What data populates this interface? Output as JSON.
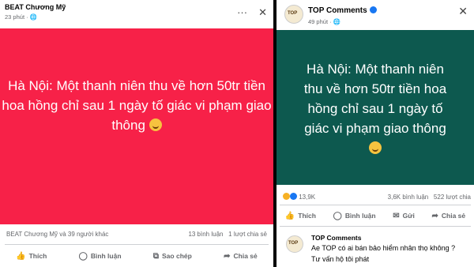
{
  "left_post": {
    "author": "BEAT Chương Mỹ",
    "time": "23 phút · 🌐",
    "text_lines": [
      "Hà Nội: Một thanh niên thu về hơn 50tr tiền",
      "hoa hồng chỉ sau 1 ngày tố giác vi phạm giao",
      "thông"
    ],
    "banner_color": "#f72148",
    "reactions": "BEAT Chương Mỹ và 39 người khác",
    "counts": "13 bình luận   1 lượt chia sẻ",
    "buttons": {
      "like": "Thích",
      "comment": "Bình luận",
      "copy": "Sao chép",
      "share": "Chia sẻ"
    }
  },
  "right_post": {
    "author": "TOP Comments",
    "time": "49 phút · 🌐",
    "text_lines": [
      "Hà Nội: Một thanh niên",
      "thu về hơn 50tr tiền hoa",
      "hồng chỉ sau 1 ngày tố",
      "giác vi phạm giao thông"
    ],
    "banner_color": "#0d594f",
    "reaction_count": "13,9K",
    "comments_count": "3,6K bình luận",
    "shares_count": "522 lượt chia",
    "buttons": {
      "like": "Thích",
      "comment": "Bình luận",
      "send": "Gửi",
      "share": "Chia sẻ"
    },
    "comment": {
      "author": "TOP Comments",
      "text_lines": [
        "Ae TOP có ai bán bảo hiểm nhân thọ không ?",
        "Tư vấn hộ tôi phát"
      ]
    }
  }
}
